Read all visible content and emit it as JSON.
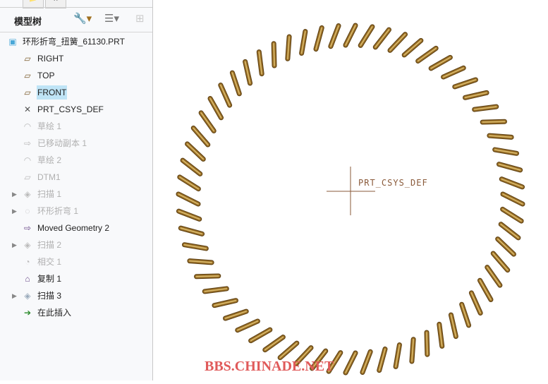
{
  "sidebar": {
    "title": "模型树",
    "items": [
      {
        "label": "环形折弯_扭簧_61130.PRT",
        "icon": "part-icon",
        "state": "normal",
        "expand": false
      },
      {
        "label": "RIGHT",
        "icon": "datum-plane-icon",
        "state": "normal",
        "expand": false
      },
      {
        "label": "TOP",
        "icon": "datum-plane-icon",
        "state": "normal",
        "expand": false
      },
      {
        "label": "FRONT",
        "icon": "datum-plane-icon",
        "state": "selected",
        "expand": false
      },
      {
        "label": "PRT_CSYS_DEF",
        "icon": "csys-icon",
        "state": "normal",
        "expand": false
      },
      {
        "label": "草绘 1",
        "icon": "sketch-icon",
        "state": "suppressed",
        "expand": false
      },
      {
        "label": "已移动副本 1",
        "icon": "moved-copy-icon",
        "state": "suppressed",
        "expand": false
      },
      {
        "label": "草绘 2",
        "icon": "sketch-icon",
        "state": "suppressed",
        "expand": false
      },
      {
        "label": "DTM1",
        "icon": "datum-plane-icon",
        "state": "suppressed",
        "expand": false
      },
      {
        "label": "扫描 1",
        "icon": "sweep-icon",
        "state": "suppressed",
        "expand": true
      },
      {
        "label": "环形折弯 1",
        "icon": "toroidal-bend-icon",
        "state": "suppressed",
        "expand": true
      },
      {
        "label": "Moved Geometry 2",
        "icon": "moved-copy-icon",
        "state": "normal",
        "expand": false
      },
      {
        "label": "扫描 2",
        "icon": "sweep-icon",
        "state": "suppressed",
        "expand": true
      },
      {
        "label": "相交 1",
        "icon": "intersect-icon",
        "state": "suppressed",
        "expand": false
      },
      {
        "label": "复制 1",
        "icon": "copy-icon",
        "state": "normal",
        "expand": false
      },
      {
        "label": "扫描 3",
        "icon": "sweep-icon",
        "state": "normal",
        "expand": true
      },
      {
        "label": "在此插入",
        "icon": "insert-here-arrow-icon",
        "state": "normal",
        "expand": false
      }
    ]
  },
  "viewport": {
    "csys_label": "PRT_CSYS_DEF",
    "coil_color": "#9a7028",
    "coil_turns": 64
  },
  "watermark": "BBS.CHINADE.NET"
}
